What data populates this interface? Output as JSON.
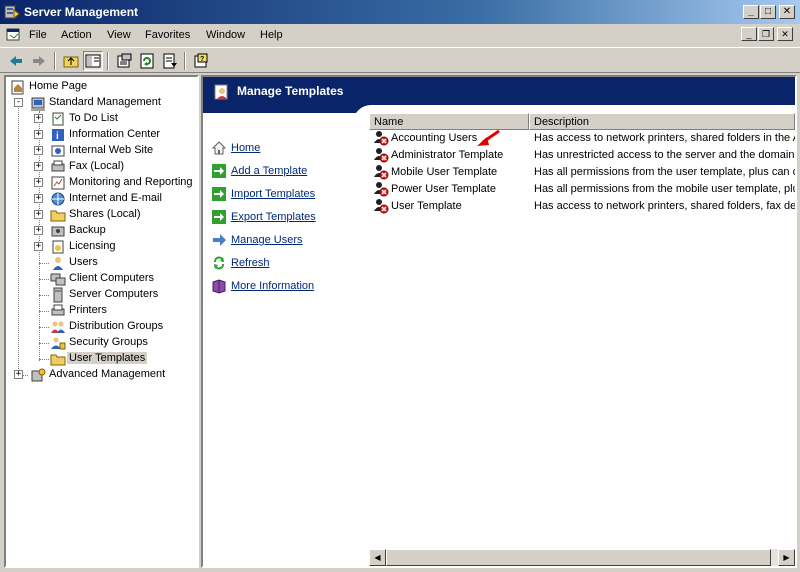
{
  "window": {
    "title": "Server Management"
  },
  "menu": [
    "File",
    "Action",
    "View",
    "Favorites",
    "Window",
    "Help"
  ],
  "tree": {
    "home": "Home Page",
    "standard": "Standard Management",
    "children": [
      "To Do List",
      "Information Center",
      "Internal Web Site",
      "Fax (Local)",
      "Monitoring and Reporting",
      "Internet and E-mail",
      "Shares (Local)",
      "Backup",
      "Licensing",
      "Users",
      "Client Computers",
      "Server Computers",
      "Printers",
      "Distribution Groups",
      "Security Groups",
      "User Templates"
    ],
    "advanced": "Advanced Management"
  },
  "banner": {
    "title": "Manage Templates"
  },
  "tasks": [
    "Home",
    "Add a Template",
    "Import Templates",
    "Export Templates",
    "Manage Users",
    "Refresh",
    "More Information"
  ],
  "list": {
    "columns": [
      "Name",
      "Description"
    ],
    "rows": [
      {
        "name": "Accounting Users",
        "desc": "Has access to network printers, shared folders in the A"
      },
      {
        "name": "Administrator Template",
        "desc": "Has unrestricted access to the server and the domain."
      },
      {
        "name": "Mobile User Template",
        "desc": "Has all permissions from the user template, plus can co"
      },
      {
        "name": "Power User Template",
        "desc": "Has all permissions from the mobile user template, plus"
      },
      {
        "name": "User Template",
        "desc": "Has access to network printers, shared folders, fax de"
      }
    ]
  },
  "colors": {
    "banner": "#0a246a",
    "link": "#00297a",
    "arrow": "#e00000"
  }
}
